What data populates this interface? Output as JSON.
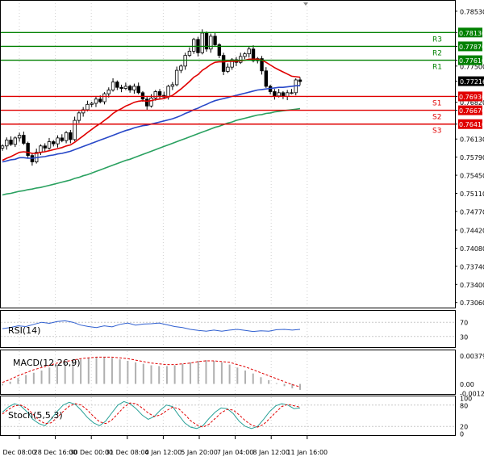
{
  "chart_data": [
    {
      "type": "candlestick",
      "panel": "price",
      "y_ticks": [
        "0.78530",
        "0.78130",
        "0.77870",
        "0.77610",
        "0.77500",
        "0.77216",
        "0.76930",
        "0.76820",
        "0.76670",
        "0.76410",
        "0.76130",
        "0.75790",
        "0.75450",
        "0.75110",
        "0.74770",
        "0.74420",
        "0.74080",
        "0.73740",
        "0.73400",
        "0.73060"
      ],
      "ylim": [
        0.7298,
        0.7868
      ],
      "current_price": "0.77216",
      "levels": [
        {
          "label": "R3",
          "value": 0.7813,
          "tag": "0.78130",
          "kind": "resistance",
          "color": "#008000"
        },
        {
          "label": "R2",
          "value": 0.7787,
          "tag": "0.77870",
          "kind": "resistance",
          "color": "#008000"
        },
        {
          "label": "R1",
          "value": 0.7761,
          "tag": "0.77610",
          "kind": "resistance",
          "color": "#008000"
        },
        {
          "label": "S1",
          "value": 0.7693,
          "tag": "0.76930",
          "kind": "support",
          "color": "#e00000"
        },
        {
          "label": "S2",
          "value": 0.7667,
          "tag": "0.76670",
          "kind": "support",
          "color": "#e00000"
        },
        {
          "label": "S3",
          "value": 0.7641,
          "tag": "0.76410",
          "kind": "support",
          "color": "#e00000"
        }
      ],
      "closes": [
        0.76,
        0.7611,
        0.7603,
        0.7615,
        0.762,
        0.7605,
        0.7582,
        0.757,
        0.7588,
        0.76,
        0.7596,
        0.7608,
        0.7604,
        0.7615,
        0.761,
        0.7625,
        0.7612,
        0.7648,
        0.7662,
        0.7668,
        0.7678,
        0.768,
        0.7688,
        0.7683,
        0.7698,
        0.7705,
        0.772,
        0.771,
        0.7708,
        0.7712,
        0.7705,
        0.7712,
        0.77,
        0.7688,
        0.7675,
        0.769,
        0.7702,
        0.7695,
        0.7692,
        0.7712,
        0.7715,
        0.7742,
        0.775,
        0.777,
        0.7778,
        0.78,
        0.7775,
        0.7812,
        0.7782,
        0.7806,
        0.779,
        0.777,
        0.774,
        0.7748,
        0.7762,
        0.7757,
        0.7768,
        0.7773,
        0.7782,
        0.776,
        0.7764,
        0.7741,
        0.7712,
        0.7702,
        0.7694,
        0.77,
        0.7693,
        0.77,
        0.77,
        0.7724,
        0.7721
      ],
      "ma_series": [
        {
          "color": "#e00000",
          "values": [
            0.7573,
            0.7577,
            0.758,
            0.7584,
            0.7588,
            0.7589,
            0.7588,
            0.7586,
            0.7586,
            0.7588,
            0.7589,
            0.7591,
            0.7593,
            0.7595,
            0.7597,
            0.76,
            0.7602,
            0.7607,
            0.7613,
            0.7619,
            0.7625,
            0.7631,
            0.7637,
            0.7642,
            0.7648,
            0.7654,
            0.7661,
            0.7666,
            0.767,
            0.7675,
            0.7678,
            0.7682,
            0.7684,
            0.7685,
            0.7684,
            0.7685,
            0.7687,
            0.7688,
            0.7689,
            0.7692,
            0.7695,
            0.7701,
            0.7707,
            0.7714,
            0.7721,
            0.7729,
            0.7734,
            0.7742,
            0.7747,
            0.7753,
            0.7757,
            0.7758,
            0.7758,
            0.7759,
            0.7759,
            0.7759,
            0.776,
            0.7761,
            0.7763,
            0.7763,
            0.7763,
            0.7761,
            0.7757,
            0.7752,
            0.7747,
            0.7743,
            0.7739,
            0.7735,
            0.7731,
            0.773,
            0.7729
          ]
        },
        {
          "color": "#2848c8",
          "values": [
            0.757,
            0.7572,
            0.7574,
            0.7575,
            0.7578,
            0.7578,
            0.7577,
            0.7577,
            0.7578,
            0.7579,
            0.758,
            0.7582,
            0.7583,
            0.7585,
            0.7586,
            0.7588,
            0.759,
            0.7593,
            0.7596,
            0.7599,
            0.7602,
            0.7605,
            0.7608,
            0.7611,
            0.7614,
            0.7617,
            0.762,
            0.7623,
            0.7626,
            0.7629,
            0.7631,
            0.7634,
            0.7636,
            0.7638,
            0.7639,
            0.7641,
            0.7643,
            0.7645,
            0.7647,
            0.7649,
            0.7651,
            0.7654,
            0.7657,
            0.7661,
            0.7664,
            0.7668,
            0.7671,
            0.7675,
            0.7678,
            0.7682,
            0.7685,
            0.7687,
            0.7689,
            0.7691,
            0.7693,
            0.7695,
            0.7697,
            0.7699,
            0.7701,
            0.7703,
            0.7705,
            0.7706,
            0.7707,
            0.7708,
            0.7709,
            0.771,
            0.771,
            0.7711,
            0.7712,
            0.7713,
            0.7713
          ]
        },
        {
          "color": "#2aa160",
          "values": [
            0.7508,
            0.751,
            0.7511,
            0.7513,
            0.7515,
            0.7516,
            0.7518,
            0.7519,
            0.7521,
            0.7522,
            0.7524,
            0.7526,
            0.7528,
            0.753,
            0.7532,
            0.7534,
            0.7536,
            0.7539,
            0.7541,
            0.7544,
            0.7546,
            0.7549,
            0.7552,
            0.7555,
            0.7558,
            0.7561,
            0.7564,
            0.7567,
            0.757,
            0.7573,
            0.7575,
            0.7578,
            0.7581,
            0.7584,
            0.7587,
            0.759,
            0.7593,
            0.7596,
            0.7599,
            0.7602,
            0.7605,
            0.7608,
            0.7611,
            0.7614,
            0.7617,
            0.762,
            0.7623,
            0.7626,
            0.7629,
            0.7632,
            0.7635,
            0.7637,
            0.764,
            0.7643,
            0.7645,
            0.7648,
            0.765,
            0.7652,
            0.7654,
            0.7656,
            0.7658,
            0.7659,
            0.7661,
            0.7662,
            0.7664,
            0.7665,
            0.7666,
            0.7667,
            0.7668,
            0.7669,
            0.767
          ]
        }
      ]
    },
    {
      "type": "line",
      "panel": "rsi",
      "title": "RSI(14)",
      "y_ticks": [
        "70",
        "30"
      ],
      "ylim": [
        0,
        100
      ],
      "line_color": "#2f5fd0",
      "values": [
        52,
        55,
        60,
        58,
        64,
        70,
        67,
        72,
        74,
        70,
        62,
        58,
        55,
        60,
        57,
        64,
        68,
        62,
        65,
        66,
        68,
        63,
        58,
        55,
        50,
        47,
        45,
        48,
        45,
        48,
        50,
        47,
        44,
        46,
        45,
        49,
        50,
        48,
        50
      ]
    },
    {
      "type": "bar+line",
      "panel": "macd",
      "title": "MACD(12,26,9)",
      "y_ticks": [
        "0.003795",
        "0.00",
        "-0.001229"
      ],
      "ylim": [
        -0.00135,
        0.0044
      ],
      "histogram": [
        -0.0002,
        0.0003,
        0.0008,
        0.0012,
        0.0015,
        0.0018,
        0.0022,
        0.0025,
        0.0028,
        0.0031,
        0.0033,
        0.0035,
        0.0036,
        0.0036,
        0.0035,
        0.0033,
        0.0031,
        0.0029,
        0.0027,
        0.0025,
        0.0024,
        0.0024,
        0.0025,
        0.0027,
        0.0029,
        0.0031,
        0.0032,
        0.0031,
        0.0029,
        0.0026,
        0.0022,
        0.0018,
        0.0014,
        0.0009,
        0.0005,
        0.0001,
        -0.0003,
        -0.0006,
        -0.0008
      ],
      "signal": [
        0.0002,
        0.0006,
        0.0011,
        0.0015,
        0.0019,
        0.0022,
        0.0025,
        0.0028,
        0.003,
        0.0032,
        0.0034,
        0.0035,
        0.0036,
        0.0036,
        0.0036,
        0.0035,
        0.0034,
        0.0032,
        0.003,
        0.0028,
        0.0027,
        0.0026,
        0.0026,
        0.0027,
        0.0028,
        0.003,
        0.0031,
        0.0031,
        0.003,
        0.0029,
        0.0026,
        0.0023,
        0.0019,
        0.0015,
        0.0011,
        0.0007,
        0.0003,
        -0.0001,
        -0.0004
      ]
    },
    {
      "type": "line",
      "panel": "stochastic",
      "title": "Stoch(5,5,3)",
      "y_ticks": [
        "100",
        "80",
        "20",
        "0"
      ],
      "ylim": [
        0,
        100
      ],
      "k_values": [
        60,
        75,
        84,
        78,
        62,
        40,
        28,
        22,
        40,
        62,
        80,
        88,
        82,
        65,
        45,
        30,
        22,
        35,
        58,
        80,
        90,
        84,
        70,
        52,
        40,
        48,
        66,
        80,
        76,
        52,
        30,
        18,
        14,
        22,
        42,
        60,
        72,
        70,
        56,
        34,
        20,
        14,
        20,
        40,
        62,
        78,
        84,
        80,
        70,
        72
      ],
      "d_values": [
        55,
        68,
        78,
        80,
        72,
        55,
        38,
        28,
        30,
        45,
        62,
        77,
        84,
        80,
        66,
        48,
        33,
        28,
        38,
        56,
        74,
        86,
        84,
        72,
        58,
        48,
        52,
        64,
        74,
        70,
        54,
        36,
        24,
        18,
        26,
        42,
        58,
        68,
        66,
        52,
        36,
        24,
        18,
        26,
        42,
        60,
        76,
        82,
        78,
        74
      ]
    }
  ],
  "time_labels": [
    "Dec 08:00",
    "28 Dec 16:00",
    "30 Dec 00:00",
    "31 Dec 08:00",
    "4 Jan 12:00",
    "5 Jan 20:00",
    "7 Jan 04:00",
    "8 Jan 12:00",
    "11 Jan 16:00"
  ]
}
